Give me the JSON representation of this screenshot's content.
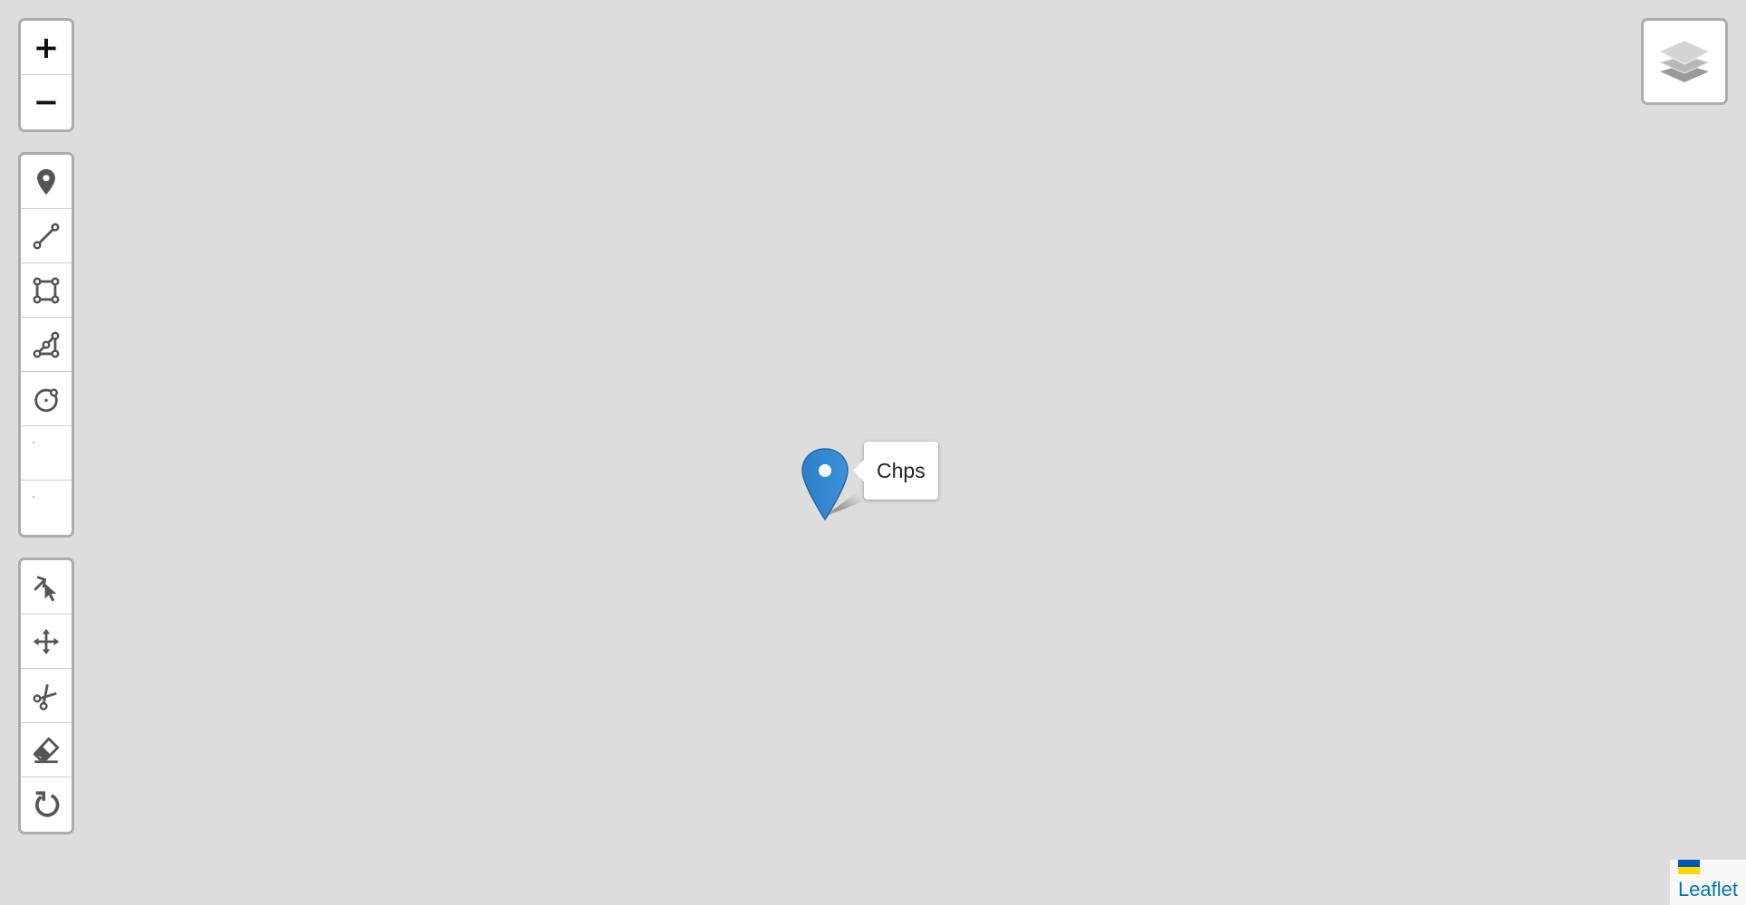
{
  "map": {
    "background_color": "#dddddd"
  },
  "zoom": {
    "zoom_in_label": "+",
    "zoom_out_label": "−"
  },
  "draw_toolbar": {
    "tools": [
      {
        "icon": "marker-icon"
      },
      {
        "icon": "polyline-icon"
      },
      {
        "icon": "rectangle-icon"
      },
      {
        "icon": "polygon-icon"
      },
      {
        "icon": "circle-icon"
      },
      {
        "icon": "blank-icon"
      },
      {
        "icon": "blank-icon"
      }
    ]
  },
  "edit_toolbar": {
    "tools": [
      {
        "icon": "edit-icon"
      },
      {
        "icon": "drag-icon"
      },
      {
        "icon": "cut-icon"
      },
      {
        "icon": "eraser-icon"
      },
      {
        "icon": "rotate-icon"
      }
    ]
  },
  "layers_control": {
    "icon": "layers-icon"
  },
  "marker": {
    "color": "#2a81cb",
    "tooltip": "Chps"
  },
  "attribution": {
    "link_text": "Leaflet",
    "link_color": "#0078a8",
    "flag_colors": [
      "#0057b7",
      "#ffd700"
    ]
  }
}
